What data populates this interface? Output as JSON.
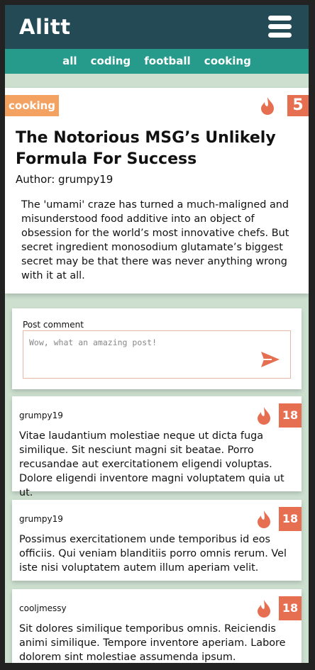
{
  "app": {
    "title": "Alitt"
  },
  "nav": {
    "items": [
      "all",
      "coding",
      "football",
      "cooking"
    ]
  },
  "post": {
    "tag": "cooking",
    "score": "5",
    "title": "The Notorious MSG’s Unlikely Formula For Success",
    "author": "Author: grumpy19",
    "body": "The 'umami' craze has turned a much-maligned and misunderstood food additive into an object of obsession for the world’s most innovative chefs. But secret ingredient monosodium glutamate’s biggest secret may be that there was never anything wrong with it at all."
  },
  "comment_form": {
    "label": "Post comment",
    "placeholder": "Wow, what an amazing post!"
  },
  "comments": [
    {
      "author": "grumpy19",
      "score": "18",
      "body": "Vitae laudantium molestiae neque ut dicta fuga similique. Sit nesciunt magni sit beatae. Porro recusandae aut exercitationem eligendi voluptas. Dolore eligendi inventore magni voluptatem quia ut ut."
    },
    {
      "author": "grumpy19",
      "score": "18",
      "body": "Possimus exercitationem unde temporibus id eos officiis. Qui veniam blanditiis porro omnis rerum. Vel iste nisi voluptatem autem illum aperiam velit."
    },
    {
      "author": "cooljmessy",
      "score": "18",
      "body": "Sit dolores similique temporibus omnis. Reiciendis animi similique. Tempore inventore aperiam. Labore dolorem sint molestiae assumenda ipsum."
    }
  ],
  "colors": {
    "header": "#244a56",
    "nav": "#269b8c",
    "accent": "#e76f51",
    "tag": "#f4a261",
    "background": "#cde0d0"
  },
  "icons": {
    "menu": "hamburger-icon",
    "upvote": "flame-icon",
    "send": "send-icon"
  }
}
